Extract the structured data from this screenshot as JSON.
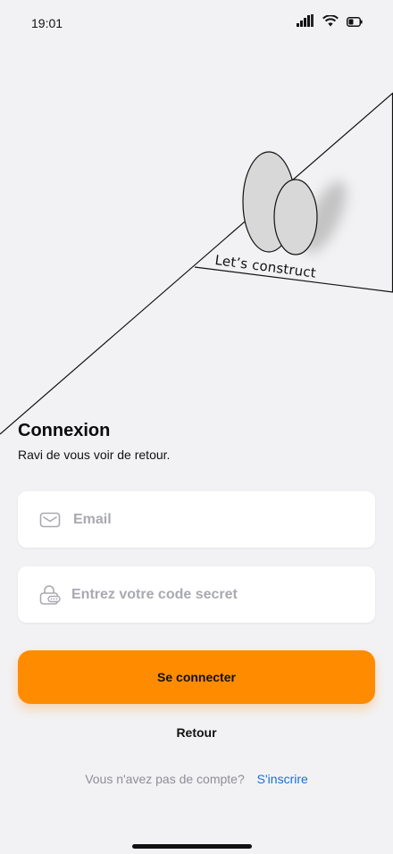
{
  "status": {
    "time": "19:01"
  },
  "hero": {
    "slogan": "Let’s construct"
  },
  "login": {
    "title": "Connexion",
    "subtitle": "Ravi de vous voir de retour.",
    "email_placeholder": "Email",
    "password_placeholder": "Entrez votre code secret",
    "submit_label": "Se connecter",
    "back_label": "Retour",
    "signup_prompt": "Vous n'avez pas de compte?",
    "signup_link": "S'inscrire"
  },
  "colors": {
    "background": "#f2f2f4",
    "accent": "#ff8c00",
    "link": "#1a6fd6",
    "placeholder": "#a9a9b2"
  },
  "icons": [
    "cellular-signal-icon",
    "wifi-icon",
    "battery-icon",
    "mail-icon",
    "lock-icon"
  ]
}
